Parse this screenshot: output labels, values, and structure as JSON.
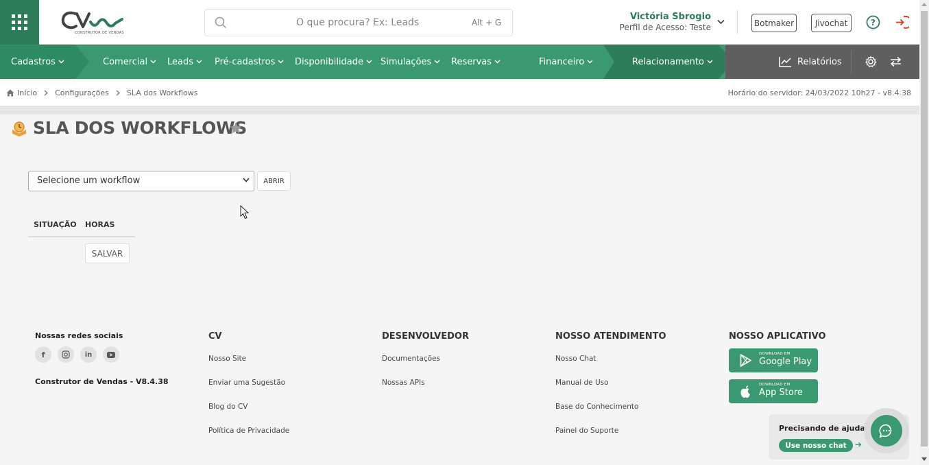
{
  "header": {
    "logo_text": "CV",
    "logo_subtitle": "CONSTRUTOR DE VENDAS",
    "search_placeholder": "O que procura? Ex: Leads",
    "search_shortcut": "Alt + G",
    "user_name": "Victória Sbrogio",
    "user_role": "Perfil de Acesso: Teste",
    "btn_botmaker": "Botmaker",
    "btn_jivochat": "Jivochat"
  },
  "nav": {
    "items": [
      {
        "label": "Cadastros"
      },
      {
        "label": "Comercial"
      },
      {
        "label": "Leads"
      },
      {
        "label": "Pré-cadastros"
      },
      {
        "label": "Disponibilidade"
      },
      {
        "label": "Simulações"
      },
      {
        "label": "Reservas"
      },
      {
        "label": "Financeiro"
      },
      {
        "label": "Relacionamento"
      }
    ],
    "reports_label": "Relatórios"
  },
  "breadcrumb": {
    "home": "Início",
    "level1": "Configurações",
    "level2": "SLA dos Workflows",
    "server_time": "Horário do servidor: 24/03/2022 10h27 - v8.4.38"
  },
  "content": {
    "page_title": "SLA DOS WORKFLOWS",
    "select_value": "Selecione um workflow",
    "btn_open": "ABRIR",
    "col_situation": "SITUAÇÃO",
    "col_hours": "HORAS",
    "btn_save": "SALVAR"
  },
  "footer": {
    "social_title": "Nossas redes sociais",
    "social_icons": [
      "facebook-icon",
      "instagram-icon",
      "linkedin-icon",
      "youtube-icon"
    ],
    "version": "Construtor de Vendas - V8.4.38",
    "col_cv": {
      "title": "CV",
      "links": [
        "Nosso Site",
        "Enviar uma Sugestão",
        "Blog do CV",
        "Política de Privacidade"
      ]
    },
    "col_dev": {
      "title": "DESENVOLVEDOR",
      "links": [
        "Documentações",
        "Nossas APIs"
      ]
    },
    "col_support": {
      "title": "NOSSO ATENDIMENTO",
      "links": [
        "Nosso Chat",
        "Manual de Uso",
        "Base do Conhecimento",
        "Painel do Suporte"
      ]
    },
    "col_app": {
      "title": "NOSSO APLICATIVO",
      "google_small": "DOWNLOAD EM",
      "google_big": "Google Play",
      "apple_small": "DOWNLOAD EM",
      "apple_big": "App Store"
    },
    "help_question": "Precisando de ajuda?",
    "help_cta": "Use nosso chat"
  },
  "colors": {
    "primary_green": "#3a9970",
    "dark_green": "#2e7d5a",
    "gray_nav": "#5f5f5f",
    "logout_red": "#d9361b"
  }
}
